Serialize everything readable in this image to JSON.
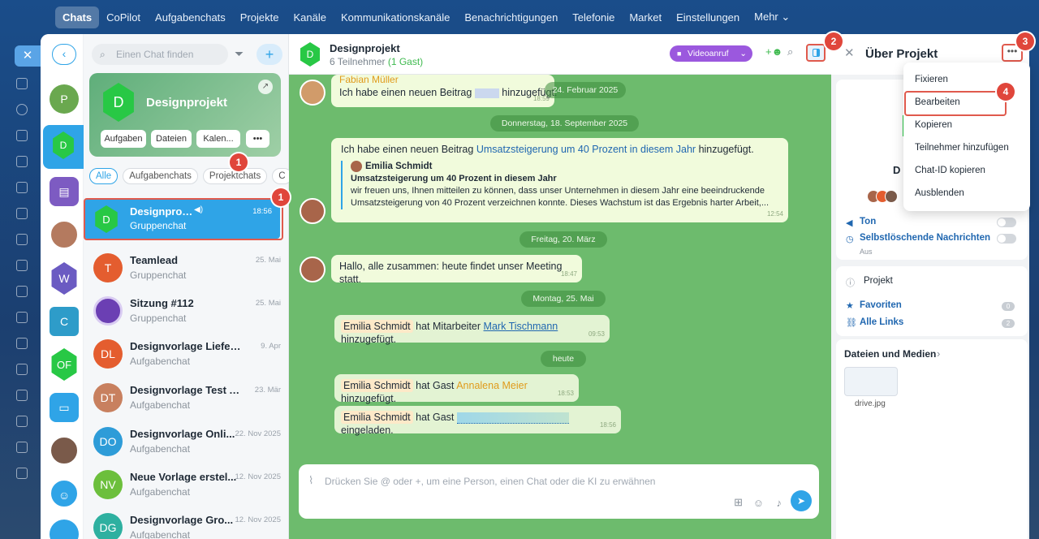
{
  "topnav": {
    "items": [
      "Chats",
      "CoPilot",
      "Aufgabenchats",
      "Projekte",
      "Kanäle",
      "Kommunikationskanäle",
      "Benachrichtigungen",
      "Telefonie",
      "Market",
      "Einstellungen",
      "Mehr ⌄"
    ]
  },
  "search": {
    "placeholder": "Einen Chat finden"
  },
  "card": {
    "initial": "D",
    "title": "Designprojekt",
    "buttons": [
      "Aufgaben",
      "Dateien",
      "Kalen...",
      "•••"
    ]
  },
  "tabs": [
    "Alle",
    "Aufgabenchats",
    "Projektchats",
    "C"
  ],
  "rail_avatars": [
    "P",
    "D",
    "",
    "",
    "W",
    "C",
    "OF",
    "",
    ""
  ],
  "chats": [
    {
      "initial": "D",
      "name": "Designprojekt",
      "sub": "Gruppenchat",
      "date": "18:56"
    },
    {
      "initial": "T",
      "name": "Teamlead",
      "sub": "Gruppenchat",
      "date": "25. Mai"
    },
    {
      "initial": "",
      "name": "Sitzung #112",
      "sub": "Gruppenchat",
      "date": "25. Mai"
    },
    {
      "initial": "DL",
      "name": "Designvorlage Lieferung ...",
      "sub": "Aufgabenchat",
      "date": "9. Apr"
    },
    {
      "initial": "DT",
      "name": "Designvorlage Test Auft...",
      "sub": "Aufgabenchat",
      "date": "23. Mär"
    },
    {
      "initial": "DO",
      "name": "Designvorlage Onli...",
      "sub": "Aufgabenchat",
      "date": "22. Nov 2025"
    },
    {
      "initial": "NV",
      "name": "Neue Vorlage erstel...",
      "sub": "Aufgabenchat",
      "date": "12. Nov 2025"
    },
    {
      "initial": "DG",
      "name": "Designvorlage Gro...",
      "sub": "Aufgabenchat",
      "date": "12. Nov 2025"
    }
  ],
  "header": {
    "initial": "D",
    "title": "Designprojekt",
    "participants": "6 Teilnehmer",
    "guest": "(1 Gast)",
    "video": "Videoanruf"
  },
  "messages": {
    "m1_author": "Fabian Müller",
    "m1_text": "Ich habe einen neuen Beitrag",
    "m1_tail": "hinzugefügt.",
    "m1_date_pill": "24. Februar 2025",
    "m1_time": "18:59",
    "date1": "Donnerstag, 18. September 2025",
    "m2_pre": "Ich habe einen neuen Beitrag",
    "m2_link": "Umsatzsteigerung um 40 Prozent in diesem Jahr",
    "m2_post": "hinzugefügt.",
    "m2_quote_author": "Emilia Schmidt",
    "m2_quote_title": "Umsatzsteigerung um 40 Prozent in diesem Jahr",
    "m2_quote_body1": "wir freuen uns, Ihnen mitteilen zu können, dass unser Unternehmen in diesem Jahr eine beeindruckende",
    "m2_quote_body2": "Umsatzsteigerung von 40 Prozent verzeichnen konnte. Dieses Wachstum ist das Ergebnis harter Arbeit,...",
    "m2_time": "12:54",
    "date2": "Freitag, 20. März",
    "m3_text": "Hallo, alle zusammen: heute findet unser Meeting statt.",
    "m3_time": "18:47",
    "date3": "Montag, 25. Mai",
    "s1_name": "Emilia Schmidt",
    "s1_mid": "hat Mitarbeiter",
    "s1_link": "Mark Tischmann",
    "s1_end": "hinzugefügt.",
    "s1_time": "09:53",
    "date4": "heute",
    "s2_name": "Emilia Schmidt",
    "s2_mid": "hat Gast",
    "s2_link": "Annalena Meier",
    "s2_end": "hinzugefügt.",
    "s2_time": "18:53",
    "s3_name": "Emilia Schmidt",
    "s3_mid": "hat Gast",
    "s3_end": "eingeladen.",
    "s3_time": "18:56"
  },
  "input": {
    "placeholder": "Drücken Sie @ oder +, um eine Person, einen Chat oder die KI zu erwähnen"
  },
  "right": {
    "title": "Über Projekt",
    "d_letter": "D",
    "ton": "Ton",
    "selfdel": "Selbstlöschende Nachrichten",
    "selfdel_state": "Aus",
    "projekt": "Projekt",
    "favoriten": "Favoriten",
    "fav_count": "0",
    "links": "Alle Links",
    "links_count": "2",
    "files": "Dateien und Medien",
    "file_name": "drive.jpg"
  },
  "menu": {
    "items": [
      "Fixieren",
      "Bearbeiten",
      "Kopieren",
      "Teilnehmer hinzufügen",
      "Chat-ID kopieren",
      "Ausblenden"
    ]
  },
  "badges": [
    "1",
    "2",
    "3",
    "4"
  ],
  "colors": {
    "accent": "#2fa4e7",
    "highlight": "#e05a4d",
    "chat_bg": "#6dbb6d",
    "video": "#9b58de"
  }
}
